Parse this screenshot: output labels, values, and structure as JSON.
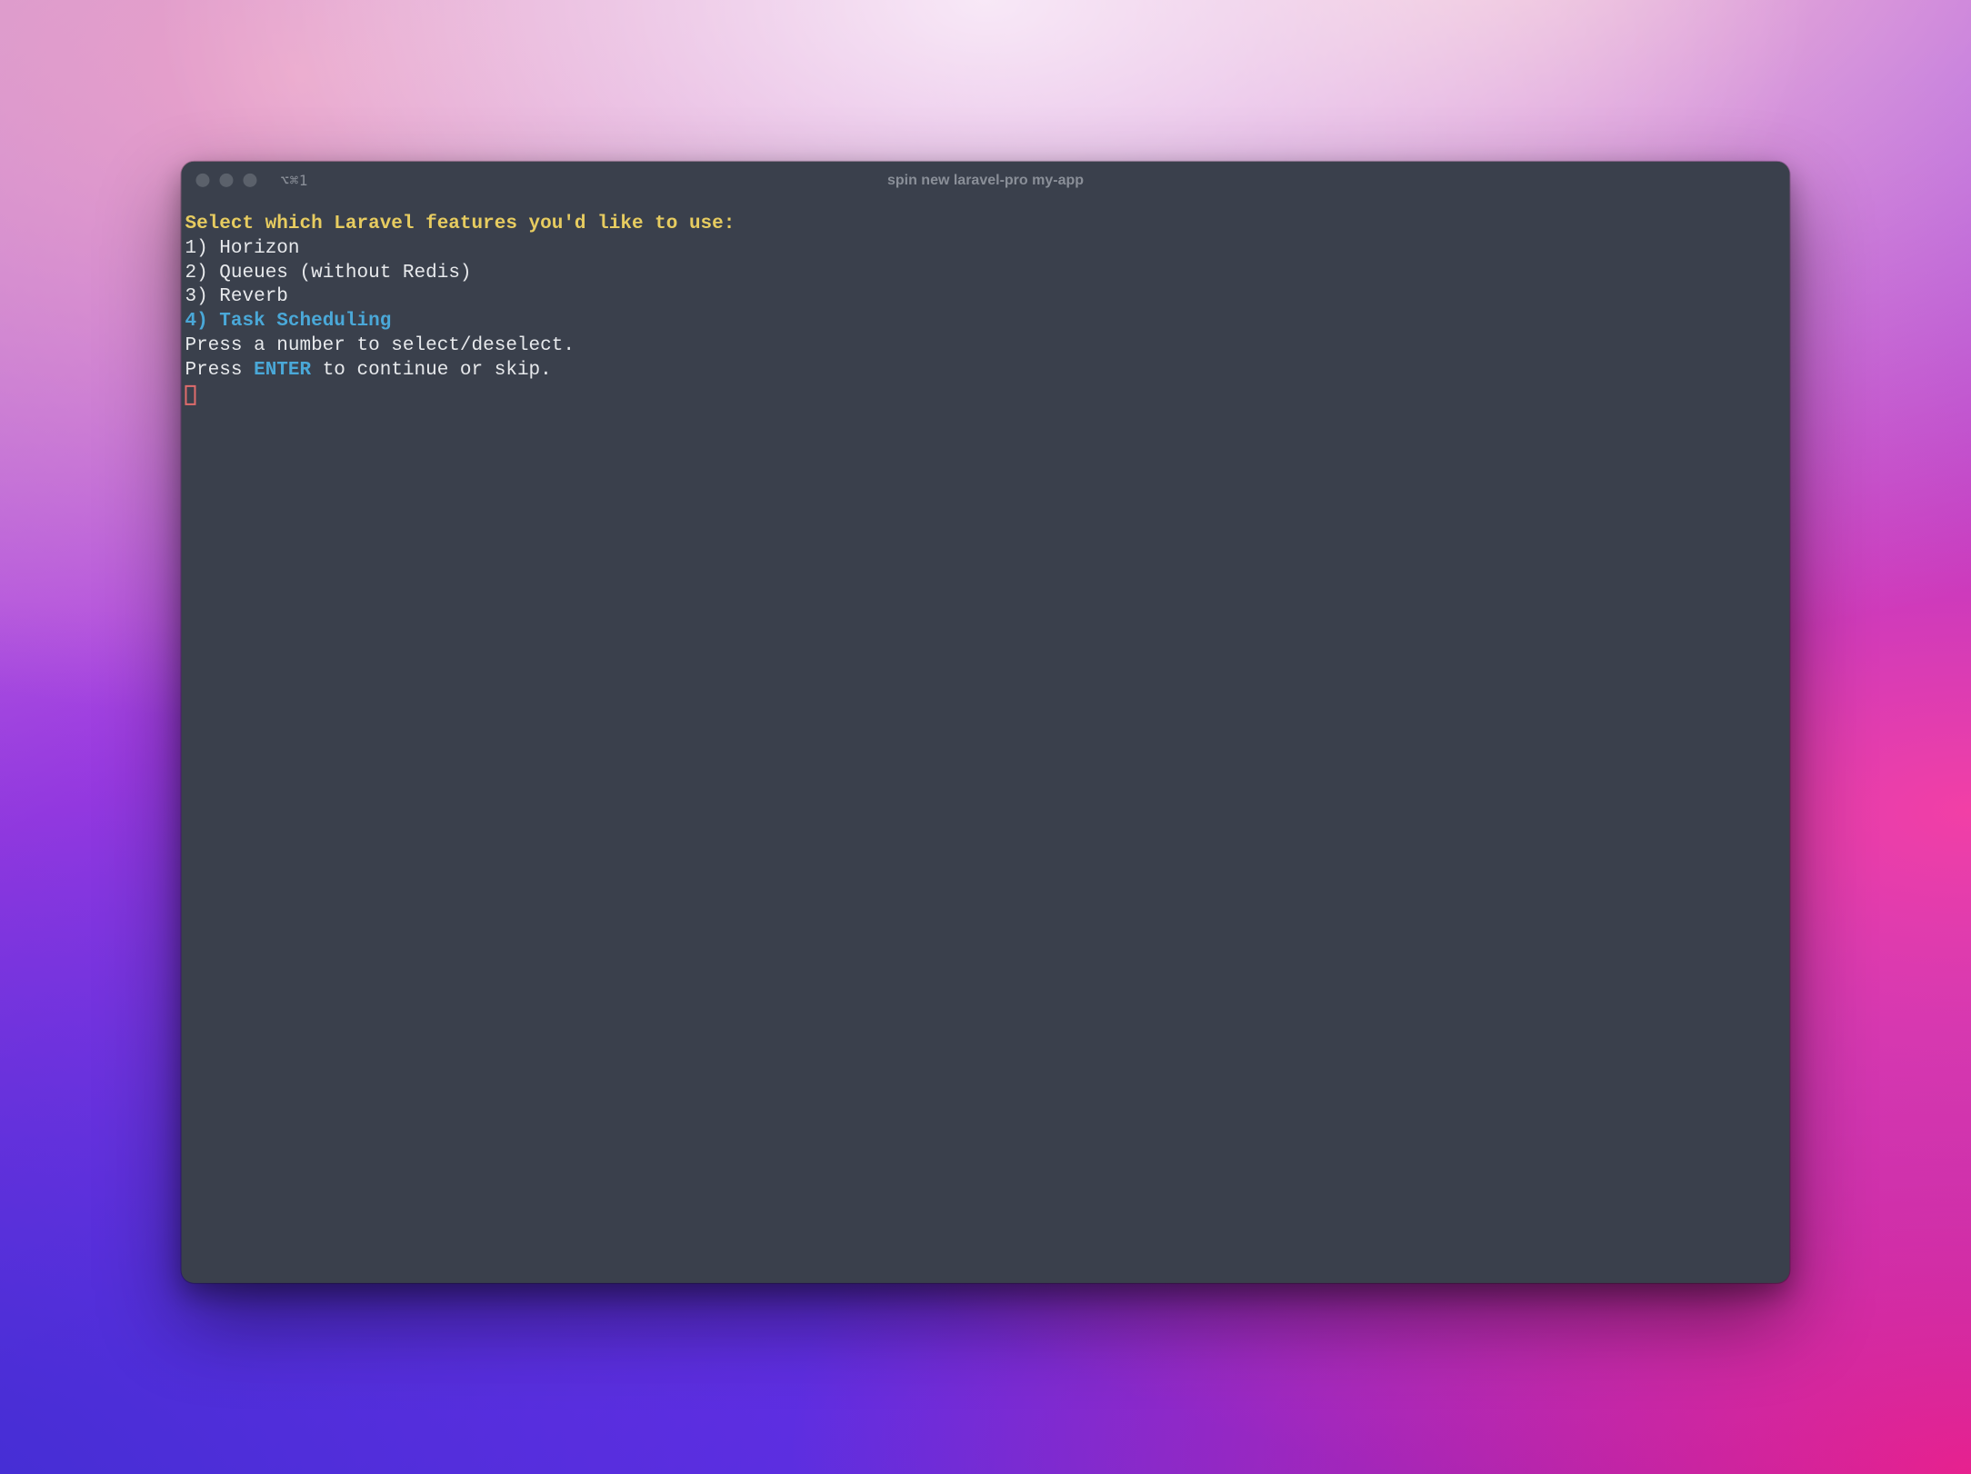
{
  "window": {
    "tab_label": "⌥⌘1",
    "title": "spin new laravel-pro my-app"
  },
  "prompt": {
    "heading": "Select which Laravel features you'd like to use:",
    "options": [
      {
        "index": "1)",
        "label": "Horizon",
        "selected": false
      },
      {
        "index": "2)",
        "label": "Queues (without Redis)",
        "selected": false
      },
      {
        "index": "3)",
        "label": "Reverb",
        "selected": false
      },
      {
        "index": "4)",
        "label": "Task Scheduling",
        "selected": true
      }
    ],
    "instruction_1": "Press a number to select/deselect.",
    "instruction_2_prefix": "Press ",
    "instruction_2_key": "ENTER",
    "instruction_2_suffix": " to continue or skip."
  }
}
